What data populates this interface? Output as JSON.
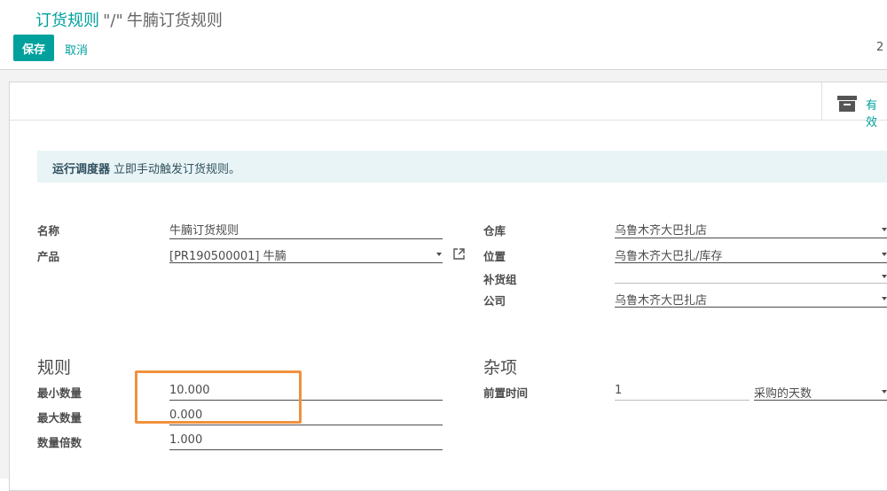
{
  "breadcrumb": {
    "parent": "订货规则",
    "separator": "\"/\"",
    "current": "牛腩订货规则"
  },
  "toolbar": {
    "save_label": "保存",
    "cancel_label": "取消",
    "pager_text": "2"
  },
  "button_box": {
    "active_label": "有效"
  },
  "alert": {
    "title": "运行调度器",
    "text": "立即手动触发订货规则。"
  },
  "fields": {
    "name": {
      "label": "名称",
      "value": "牛腩订货规则"
    },
    "product": {
      "label": "产品",
      "value": "[PR190500001] 牛腩"
    },
    "warehouse": {
      "label": "仓库",
      "value": "乌鲁木齐大巴扎店"
    },
    "location": {
      "label": "位置",
      "value": "乌鲁木齐大巴扎/库存"
    },
    "procurement_group": {
      "label": "补货组",
      "value": ""
    },
    "company": {
      "label": "公司",
      "value": "乌鲁木齐大巴扎店"
    }
  },
  "rules_section": {
    "title": "规则",
    "min_qty": {
      "label": "最小数量",
      "value": "10.000"
    },
    "max_qty": {
      "label": "最大数量",
      "value": "0.000"
    },
    "qty_multiple": {
      "label": "数量倍数",
      "value": "1.000"
    }
  },
  "misc_section": {
    "title": "杂项",
    "lead_time": {
      "label": "前置时间",
      "value": "1",
      "unit": "采购的天数"
    }
  },
  "colors": {
    "primary": "#00a09d",
    "highlight": "#f0913f",
    "alert_bg": "#e8f4f5"
  }
}
